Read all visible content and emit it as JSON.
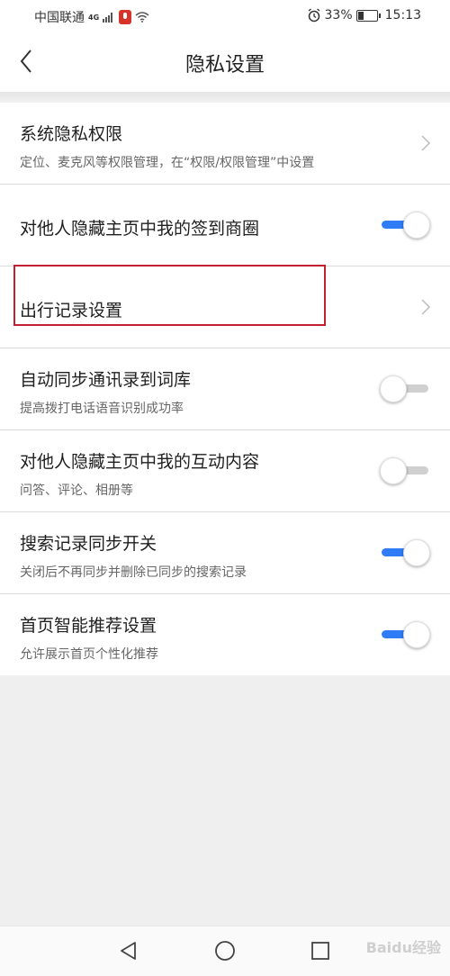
{
  "status_bar": {
    "carrier": "中国联通",
    "network": "4G",
    "battery": "33%",
    "battery_level": 0.33,
    "time": "15:13",
    "icons": [
      "signal-icon",
      "mic-icon",
      "wifi-icon",
      "alarm-icon",
      "battery-icon"
    ]
  },
  "nav": {
    "back_icon": "chevron-left-icon",
    "title": "隐私设置"
  },
  "settings": [
    {
      "title": "系统隐私权限",
      "subtitle": "定位、麦克风等权限管理，在“权限/权限管理”中设置",
      "control": "chevron"
    },
    {
      "title": "对他人隐藏主页中我的签到商圈",
      "control": "toggle",
      "on": true
    },
    {
      "title": "出行记录设置",
      "control": "chevron",
      "highlighted": true
    },
    {
      "title": "自动同步通讯录到词库",
      "subtitle": "提高拨打电话语音识别成功率",
      "control": "toggle",
      "on": false
    },
    {
      "title": "对他人隐藏主页中我的互动内容",
      "subtitle": "问答、评论、相册等",
      "control": "toggle",
      "on": false
    },
    {
      "title": "搜索记录同步开关",
      "subtitle": "关闭后不再同步并删除已同步的搜索记录",
      "control": "toggle",
      "on": true
    },
    {
      "title": "首页智能推荐设置",
      "subtitle": "允许展示首页个性化推荐",
      "control": "toggle",
      "on": true
    }
  ],
  "colors": {
    "toggle_on": "#2f7cf6",
    "toggle_off": "#d0d0d0",
    "highlight": "#c21f30"
  },
  "system_nav": {
    "icons": [
      "back-triangle-icon",
      "home-circle-icon",
      "recents-square-icon"
    ]
  },
  "watermark": "Baidu经验"
}
